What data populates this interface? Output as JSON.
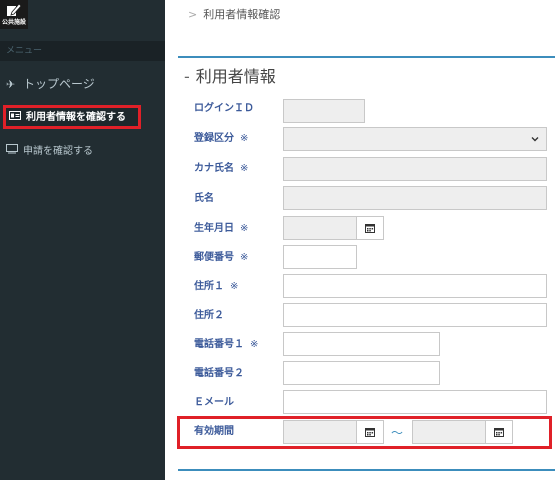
{
  "logo": {
    "text": "公共施設",
    "icon": "edit-document-icon"
  },
  "sidebar": {
    "menu_header": "メニュー",
    "items": [
      {
        "label": "トップページ",
        "icon": "plane-icon"
      },
      {
        "label": "利用者情報を確認する",
        "icon": "id-card-icon"
      },
      {
        "label": "申請を確認する",
        "icon": "monitor-icon"
      }
    ]
  },
  "breadcrumb": {
    "separator": ">",
    "current": "利用者情報確認"
  },
  "section": {
    "dash": "-",
    "title": "利用者情報"
  },
  "form": {
    "login_id": {
      "label": "ログインＩＤ",
      "value": ""
    },
    "registration_type": {
      "label": "登録区分",
      "required": "※",
      "value": ""
    },
    "kana_name": {
      "label": "カナ氏名",
      "required": "※",
      "value": ""
    },
    "name": {
      "label": "氏名",
      "value": ""
    },
    "birthdate": {
      "label": "生年月日",
      "required": "※",
      "value": ""
    },
    "postal_code": {
      "label": "郵便番号",
      "required": "※",
      "value": ""
    },
    "address1": {
      "label": "住所１",
      "required": "※",
      "value": ""
    },
    "address2": {
      "label": "住所２",
      "value": ""
    },
    "phone1": {
      "label": "電話番号１",
      "required": "※",
      "value": ""
    },
    "phone2": {
      "label": "電話番号２",
      "value": ""
    },
    "email": {
      "label": "Ｅメール",
      "value": ""
    },
    "validity": {
      "label": "有効期間",
      "separator": "～",
      "start": "",
      "end": ""
    }
  },
  "colors": {
    "sidebar_bg": "#222d32",
    "label_blue": "#3c5a9a",
    "accent": "#3c8dbc",
    "highlight_red": "#e02028"
  }
}
